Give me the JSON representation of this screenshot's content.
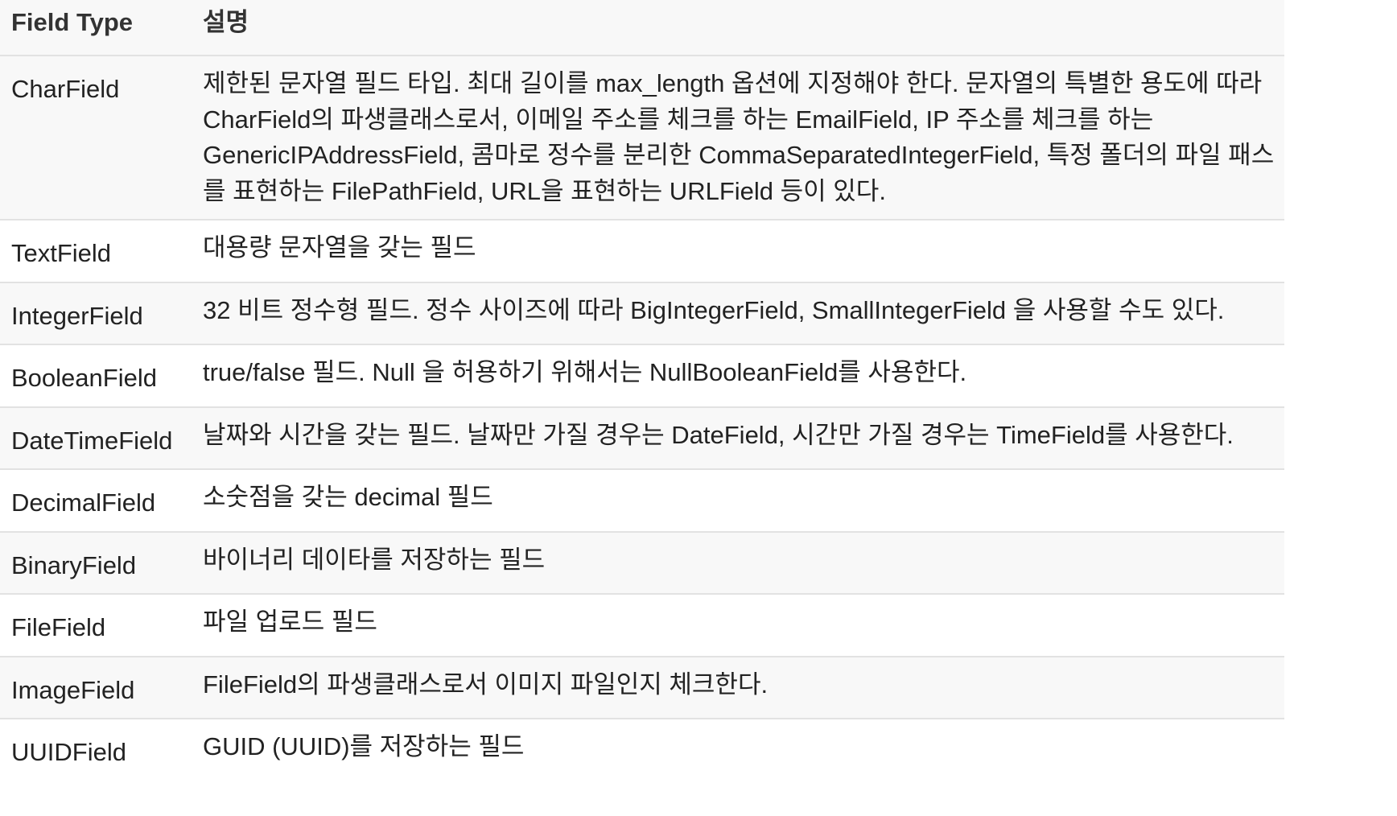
{
  "table": {
    "headers": {
      "field_type": "Field Type",
      "description": "설명"
    },
    "rows": [
      {
        "type": "CharField",
        "desc": "제한된 문자열 필드 타입. 최대 길이를 max_length 옵션에 지정해야 한다. 문자열의 특별한 용도에 따라 CharField의 파생클래스로서, 이메일 주소를 체크를 하는 EmailField, IP 주소를 체크를 하는 GenericIPAddressField, 콤마로 정수를 분리한 CommaSeparatedIntegerField, 특정 폴더의 파일 패스를 표현하는 FilePathField, URL을 표현하는 URLField 등이 있다."
      },
      {
        "type": "TextField",
        "desc": "대용량 문자열을 갖는 필드"
      },
      {
        "type": "IntegerField",
        "desc": "32 비트 정수형 필드. 정수 사이즈에 따라 BigIntegerField, SmallIntegerField 을 사용할 수도 있다."
      },
      {
        "type": "BooleanField",
        "desc": "true/false 필드. Null 을 허용하기 위해서는 NullBooleanField를 사용한다."
      },
      {
        "type": "DateTimeField",
        "desc": "날짜와 시간을 갖는 필드. 날짜만 가질 경우는 DateField, 시간만 가질 경우는 TimeField를 사용한다."
      },
      {
        "type": "DecimalField",
        "desc": "소숫점을 갖는 decimal 필드"
      },
      {
        "type": "BinaryField",
        "desc": "바이너리 데이타를 저장하는 필드"
      },
      {
        "type": "FileField",
        "desc": "파일 업로드 필드"
      },
      {
        "type": "ImageField",
        "desc": "FileField의 파생클래스로서 이미지 파일인지 체크한다."
      },
      {
        "type": "UUIDField",
        "desc": "GUID (UUID)를 저장하는 필드"
      }
    ]
  }
}
